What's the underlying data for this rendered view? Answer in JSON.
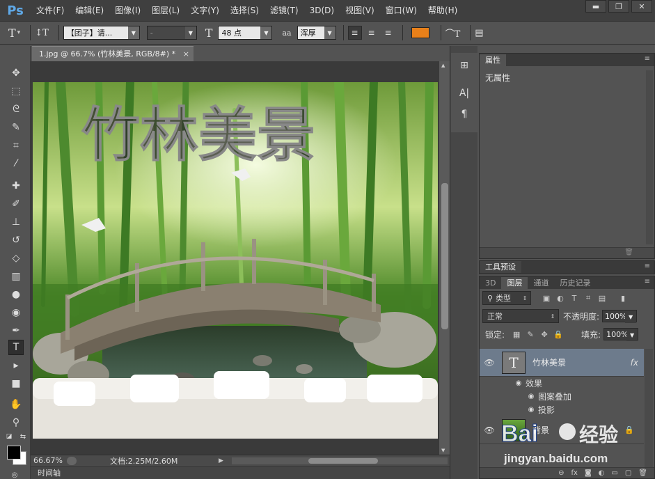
{
  "app": {
    "logo": "Ps"
  },
  "menu": [
    "文件(F)",
    "编辑(E)",
    "图像(I)",
    "图层(L)",
    "文字(Y)",
    "选择(S)",
    "滤镜(T)",
    "3D(D)",
    "视图(V)",
    "窗口(W)",
    "帮助(H)"
  ],
  "window_controls": {
    "minimize": "▬",
    "restore": "❐",
    "close": "✕"
  },
  "options": {
    "tool_icon": "T",
    "orient_icon": "↕T",
    "font_family": "【团子】请...",
    "font_style": "-",
    "size_icon": "T",
    "font_size": "48 点",
    "aa_icon": "aa",
    "anti_alias": "浑厚",
    "text_color": "#e8801a"
  },
  "document": {
    "tab_title": "1.jpg @ 66.7% (竹林美景, RGB/8#) *",
    "tab_close": "×",
    "canvas_text": "竹林美景"
  },
  "status": {
    "zoom": "66.67%",
    "doc_size": "文档:2.25M/2.60M"
  },
  "timeline": "时间轴",
  "properties": {
    "tab": "属性",
    "content": "无属性"
  },
  "presets": {
    "tab": "工具预设"
  },
  "layers_panel": {
    "tabs": [
      "3D",
      "图层",
      "通道",
      "历史记录"
    ],
    "filter": "类型",
    "blend_mode": "正常",
    "opacity_label": "不透明度:",
    "opacity": "100%",
    "lock_label": "锁定:",
    "fill_label": "填充:",
    "fill": "100%",
    "layers": [
      {
        "name": "竹林美景",
        "type": "text",
        "fx": "fx",
        "selected": true
      },
      {
        "name": "背景",
        "type": "image",
        "selected": false
      }
    ],
    "effects_label": "效果",
    "effects": [
      "图案叠加",
      "投影"
    ]
  },
  "watermark": {
    "brand": "Bai",
    "brand2": "经验",
    "url": "jingyan.baidu.com"
  }
}
